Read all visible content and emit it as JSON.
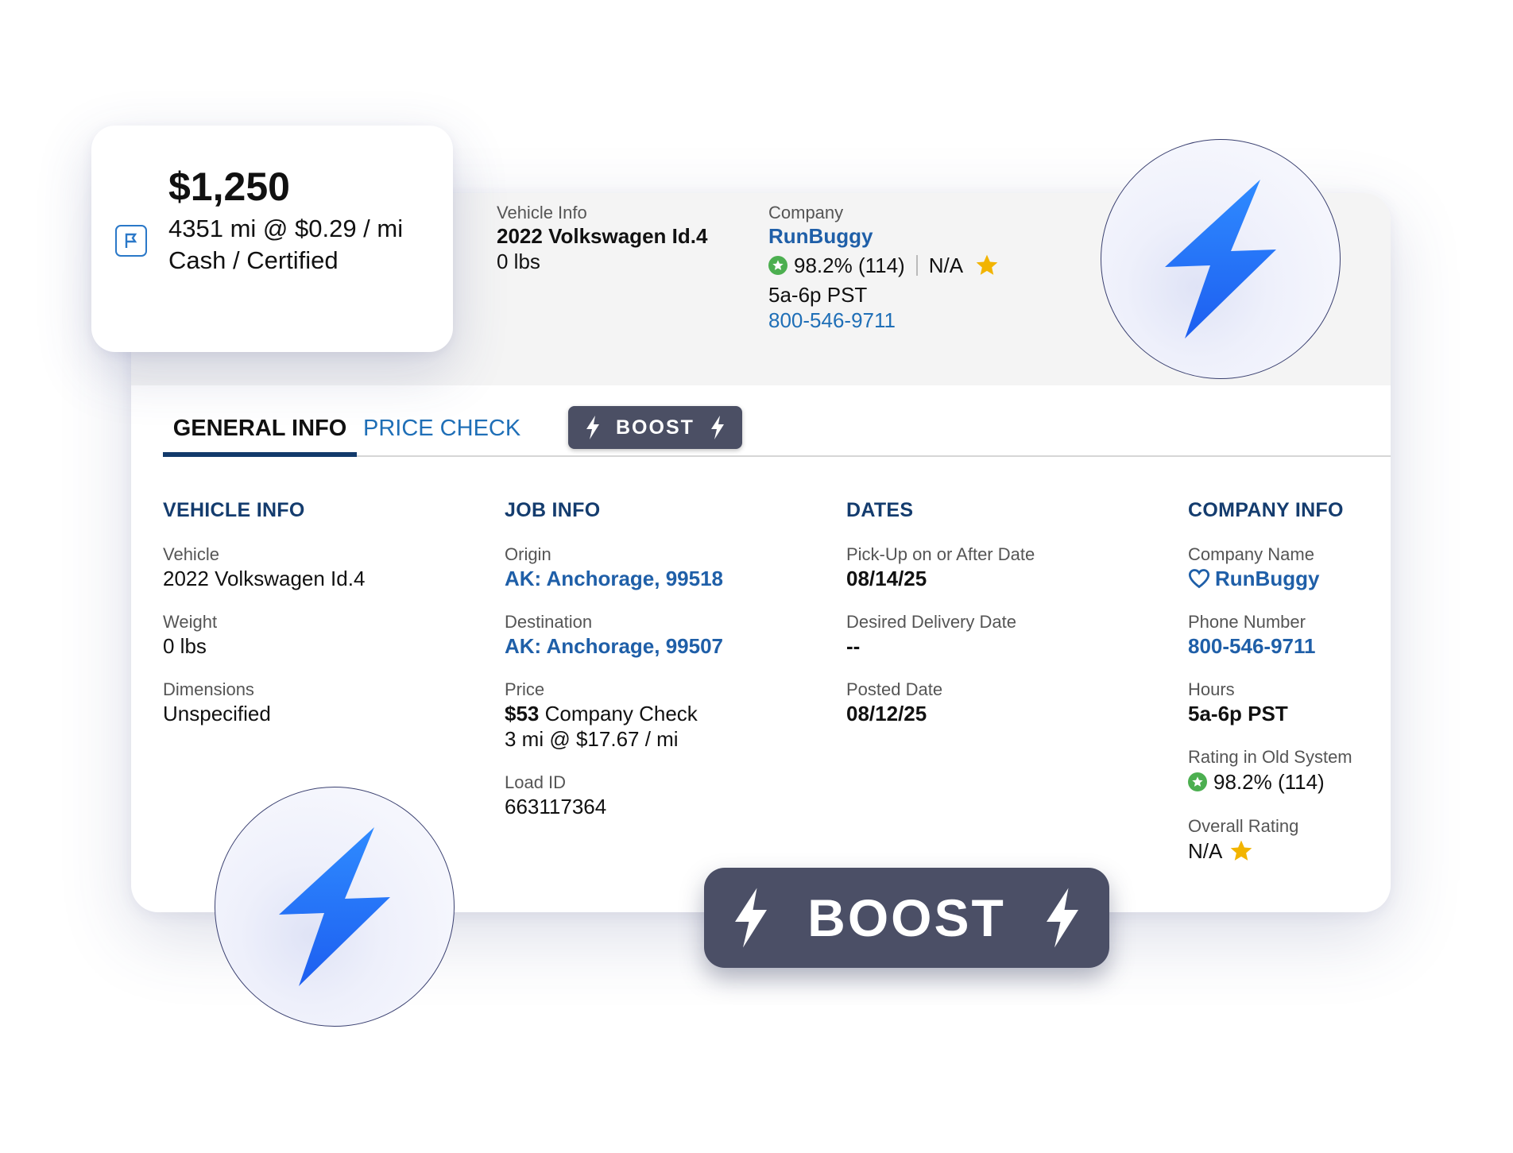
{
  "price_card": {
    "amount": "$1,250",
    "distance_rate": "4351 mi @ $0.29 / mi",
    "payment": "Cash / Certified"
  },
  "summary": {
    "vehicle_label": "Vehicle Info",
    "vehicle_name": "2022 Volkswagen Id.4",
    "vehicle_weight": "0 lbs",
    "company_label": "Company",
    "company_name": "RunBuggy",
    "rating": "98.2% (114)",
    "overall": "N/A",
    "hours": "5a-6p PST",
    "phone": "800-546-9711"
  },
  "tabs": {
    "general": "GENERAL INFO",
    "price_check": "PRICE CHECK",
    "boost": "BOOST"
  },
  "vehicle_info": {
    "title": "VEHICLE INFO",
    "vehicle_label": "Vehicle",
    "vehicle_value": "2022 Volkswagen Id.4",
    "weight_label": "Weight",
    "weight_value": "0 lbs",
    "dimensions_label": "Dimensions",
    "dimensions_value": "Unspecified"
  },
  "job_info": {
    "title": "JOB INFO",
    "origin_label": "Origin",
    "origin_value": "AK: Anchorage, 99518",
    "destination_label": "Destination",
    "destination_value": "AK: Anchorage, 99507",
    "price_label": "Price",
    "price_amount": "$53",
    "price_note": " Company Check",
    "price_rate": "3 mi @ $17.67 / mi",
    "load_label": "Load ID",
    "load_value": "663117364"
  },
  "dates": {
    "title": "DATES",
    "pickup_label": "Pick-Up on or After Date",
    "pickup_value": "08/14/25",
    "delivery_label": "Desired Delivery Date",
    "delivery_value": "--",
    "posted_label": "Posted Date",
    "posted_value": "08/12/25"
  },
  "company_info": {
    "title": "COMPANY INFO",
    "name_label": "Company Name",
    "name_value": "RunBuggy",
    "phone_label": "Phone Number",
    "phone_value": "800-546-9711",
    "hours_label": "Hours",
    "hours_value": "5a-6p PST",
    "old_rating_label": "Rating in Old System",
    "old_rating_value": "98.2% (114)",
    "overall_label": "Overall Rating",
    "overall_value": "N/A"
  },
  "boost_button": {
    "label": "BOOST"
  },
  "icons": {
    "flag": "flag-icon",
    "bolt": "lightning-bolt-icon",
    "star": "star-icon",
    "rating_badge": "star-badge-icon",
    "heart": "heart-icon"
  },
  "colors": {
    "accent_blue": "#1f6fb7",
    "heading_navy": "#143c6e",
    "boost_bg": "#4b4f64",
    "star_gold": "#f2b400",
    "rating_green": "#4caf50",
    "bolt_blue": "#1a6cf5"
  }
}
